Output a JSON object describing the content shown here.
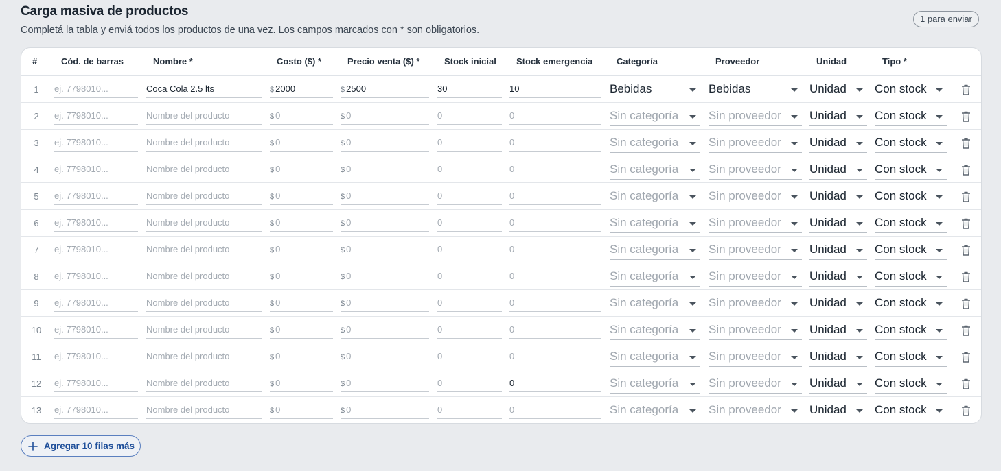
{
  "header": {
    "title": "Carga masiva de productos",
    "subtitle": "Completá la tabla y enviá todos los productos de una vez. Los campos marcados con * son obligatorios.",
    "badge": "1 para enviar"
  },
  "table": {
    "columns": [
      "#",
      "Cód. de barras",
      "Nombre *",
      "Costo ($) *",
      "Precio venta ($) *",
      "Stock inicial",
      "Stock emergencia",
      "Categoría",
      "Proveedor",
      "Unidad",
      "Tipo *"
    ],
    "placeholders": {
      "barcode": "ej. 7798010...",
      "name": "Nombre del producto",
      "cost": "0",
      "price": "0",
      "stock": "0",
      "emergency": "0",
      "category": "Sin categoría",
      "supplier": "Sin proveedor"
    },
    "currency_symbol": "$",
    "rows": [
      {
        "n": "1",
        "barcode": "",
        "name": "Coca Cola 2.5 lts",
        "cost": "2000",
        "price": "2500",
        "stock": "30",
        "emergency": "10",
        "category": "Bebidas",
        "supplier": "Bebidas",
        "unit": "Unidad",
        "type": "Con stock"
      },
      {
        "n": "2",
        "barcode": "",
        "name": "",
        "cost": "",
        "price": "",
        "stock": "",
        "emergency": "",
        "category": "",
        "supplier": "",
        "unit": "Unidad",
        "type": "Con stock"
      },
      {
        "n": "3",
        "barcode": "",
        "name": "",
        "cost": "",
        "price": "",
        "stock": "",
        "emergency": "",
        "category": "",
        "supplier": "",
        "unit": "Unidad",
        "type": "Con stock"
      },
      {
        "n": "4",
        "barcode": "",
        "name": "",
        "cost": "",
        "price": "",
        "stock": "",
        "emergency": "",
        "category": "",
        "supplier": "",
        "unit": "Unidad",
        "type": "Con stock"
      },
      {
        "n": "5",
        "barcode": "",
        "name": "",
        "cost": "",
        "price": "",
        "stock": "",
        "emergency": "",
        "category": "",
        "supplier": "",
        "unit": "Unidad",
        "type": "Con stock"
      },
      {
        "n": "6",
        "barcode": "",
        "name": "",
        "cost": "",
        "price": "",
        "stock": "",
        "emergency": "",
        "category": "",
        "supplier": "",
        "unit": "Unidad",
        "type": "Con stock"
      },
      {
        "n": "7",
        "barcode": "",
        "name": "",
        "cost": "",
        "price": "",
        "stock": "",
        "emergency": "",
        "category": "",
        "supplier": "",
        "unit": "Unidad",
        "type": "Con stock"
      },
      {
        "n": "8",
        "barcode": "",
        "name": "",
        "cost": "",
        "price": "",
        "stock": "",
        "emergency": "",
        "category": "",
        "supplier": "",
        "unit": "Unidad",
        "type": "Con stock"
      },
      {
        "n": "9",
        "barcode": "",
        "name": "",
        "cost": "",
        "price": "",
        "stock": "",
        "emergency": "",
        "category": "",
        "supplier": "",
        "unit": "Unidad",
        "type": "Con stock"
      },
      {
        "n": "10",
        "barcode": "",
        "name": "",
        "cost": "",
        "price": "",
        "stock": "",
        "emergency": "",
        "category": "",
        "supplier": "",
        "unit": "Unidad",
        "type": "Con stock"
      },
      {
        "n": "11",
        "barcode": "",
        "name": "",
        "cost": "",
        "price": "",
        "stock": "",
        "emergency": "",
        "category": "",
        "supplier": "",
        "unit": "Unidad",
        "type": "Con stock"
      },
      {
        "n": "12",
        "barcode": "",
        "name": "",
        "cost": "",
        "price": "",
        "stock": "",
        "emergency": "0",
        "category": "",
        "supplier": "",
        "unit": "Unidad",
        "type": "Con stock"
      },
      {
        "n": "13",
        "barcode": "",
        "name": "",
        "cost": "",
        "price": "",
        "stock": "",
        "emergency": "",
        "category": "",
        "supplier": "",
        "unit": "Unidad",
        "type": "Con stock"
      }
    ]
  },
  "actions": {
    "add_rows_label": "Agregar 10 filas más",
    "add_icon": "plus-icon",
    "delete_icon": "trash-icon"
  },
  "colors": {
    "background": "#e9ebee",
    "accent": "#1f4f9a"
  }
}
